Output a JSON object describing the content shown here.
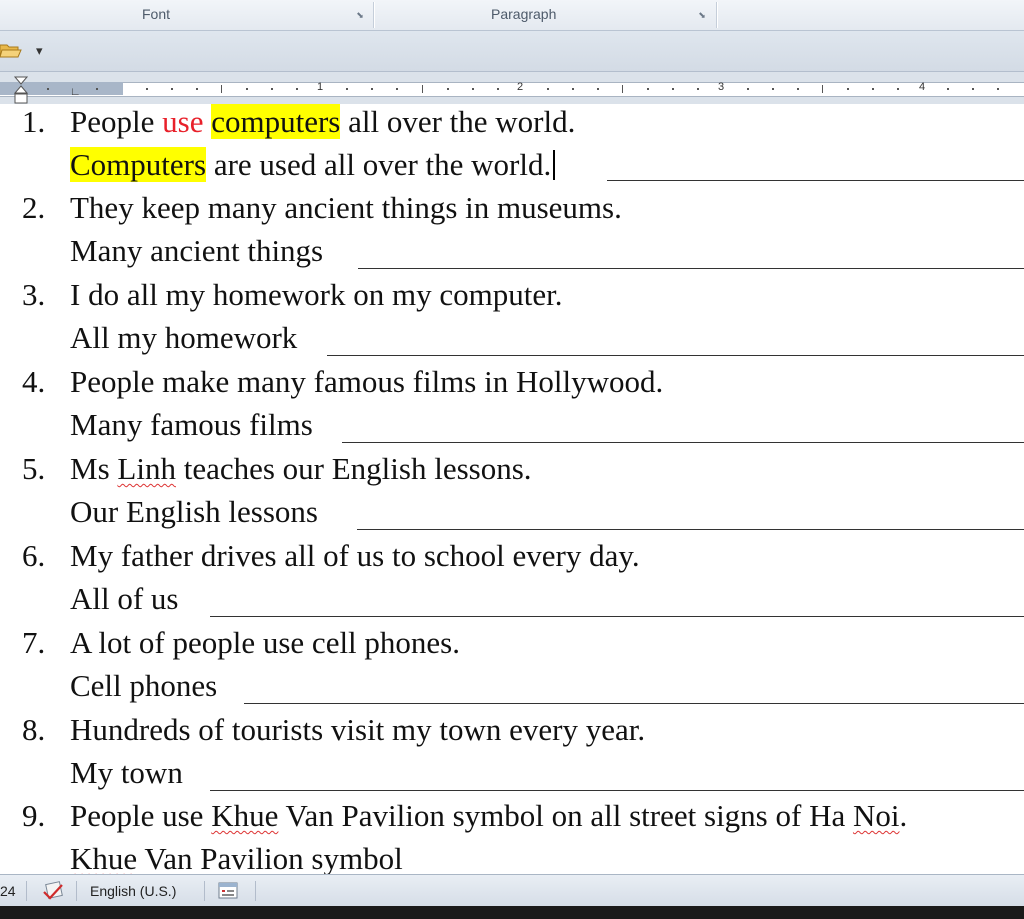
{
  "ribbon": {
    "groups": [
      {
        "label": "Font"
      },
      {
        "label": "Paragraph"
      }
    ]
  },
  "ruler": {
    "numbers": [
      "1",
      "2",
      "3",
      "4"
    ]
  },
  "document": {
    "items": [
      {
        "number": "1.",
        "sentence_parts": [
          "People ",
          "use",
          " ",
          "computers",
          " all over the world."
        ],
        "answer_parts": [
          "Computers",
          " are used all over the world."
        ]
      },
      {
        "number": "2.",
        "sentence": "They keep many ancient things in museums.",
        "answer": "Many ancient things"
      },
      {
        "number": "3.",
        "sentence": "I do all my homework on my computer.",
        "answer": "All my homework"
      },
      {
        "number": "4.",
        "sentence": "People make many famous films in Hollywood.",
        "answer": "Many famous films"
      },
      {
        "number": "5.",
        "sentence_parts": [
          "Ms ",
          "Linh",
          " teaches our English lessons."
        ],
        "answer": "Our English lessons"
      },
      {
        "number": "6.",
        "sentence": "My father drives all of us to school every day.",
        "answer": "All of us"
      },
      {
        "number": "7.",
        "sentence": "A lot of people use cell phones.",
        "answer": "Cell phones"
      },
      {
        "number": "8.",
        "sentence": "Hundreds of tourists visit my town every year.",
        "answer": "My town"
      },
      {
        "number": "9.",
        "sentence_parts": [
          "People use ",
          "Khue",
          " Van Pavilion symbol on all street signs of Ha ",
          "Noi",
          "."
        ],
        "answer_parts": [
          "Khue",
          " Van Pavilion symbol"
        ]
      }
    ]
  },
  "status_bar": {
    "page_fragment": "24",
    "language": "English (U.S.)"
  },
  "colors": {
    "highlight": "#ffff00",
    "red_text": "#e8202a"
  }
}
